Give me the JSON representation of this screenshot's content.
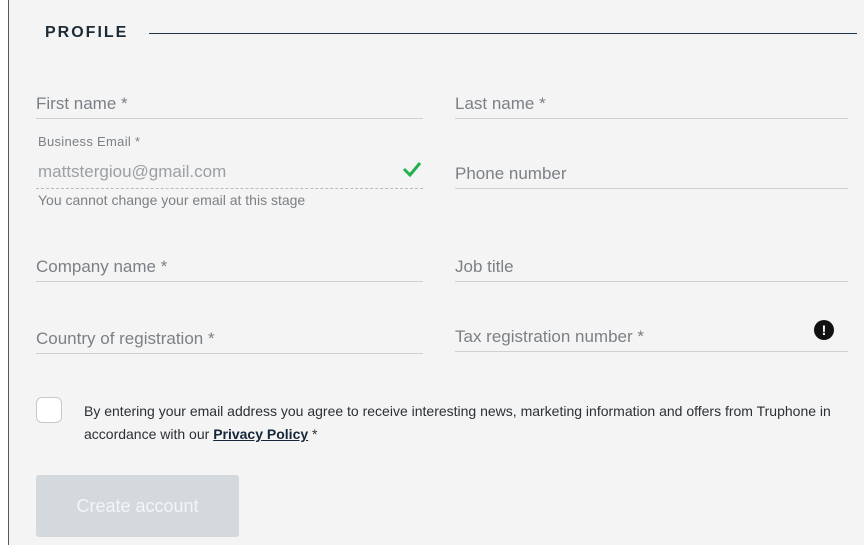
{
  "section": {
    "title": "PROFILE"
  },
  "fields": {
    "first_name": "First name *",
    "last_name": "Last name *",
    "email_label": "Business Email *",
    "email_value": "mattstergiou@gmail.com",
    "email_hint": "You cannot change your email at this stage",
    "phone": "Phone number",
    "company": "Company name *",
    "job_title": "Job title",
    "country": "Country of registration *",
    "tax": "Tax registration number *"
  },
  "consent": {
    "text": "By entering your email address you agree to receive interesting news, marketing information and offers from Truphone in accordance with our ",
    "link": "Privacy Policy",
    "suffix": " *"
  },
  "actions": {
    "create_label": "Create account"
  },
  "colors": {
    "accent_check": "#22b14c",
    "button_disabled": "#d3d9dd"
  },
  "icons": {
    "valid": "check-icon",
    "warning": "exclamation-icon"
  }
}
